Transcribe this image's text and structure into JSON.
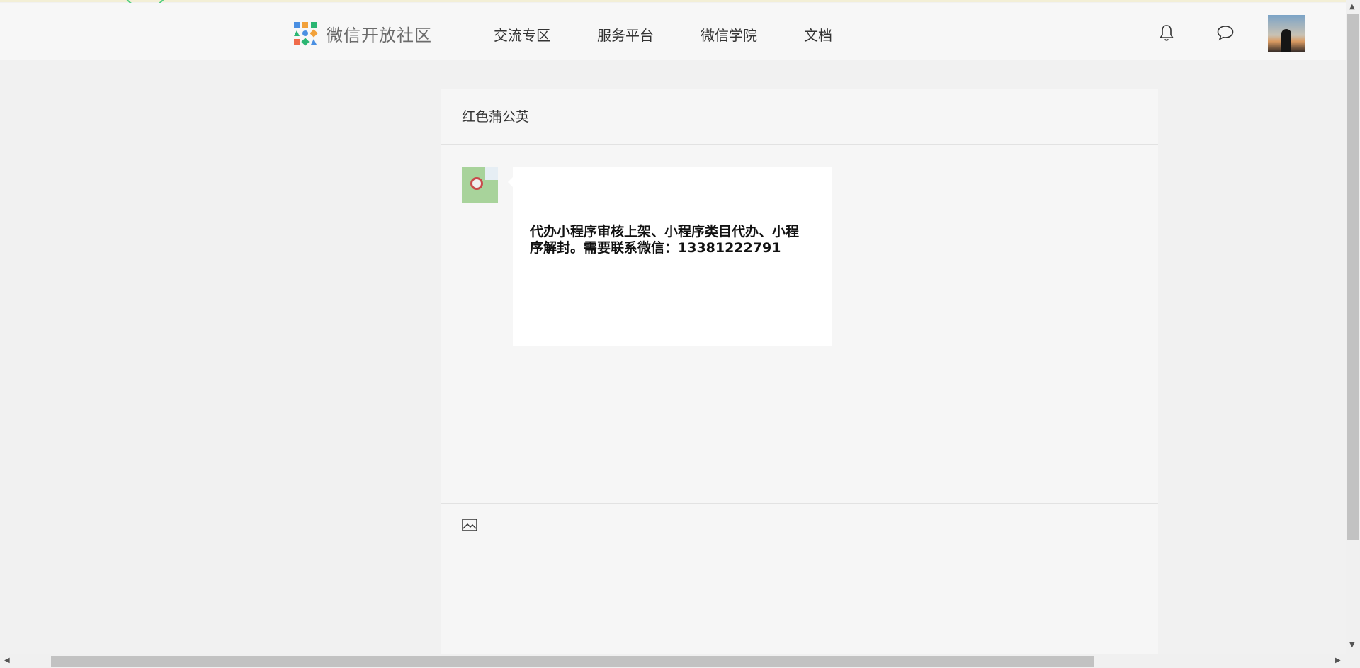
{
  "brand": {
    "name": "微信开放社区"
  },
  "nav": {
    "items": [
      "交流专区",
      "服务平台",
      "微信学院",
      "文档"
    ]
  },
  "header_icons": [
    "bell-icon",
    "chat-icon"
  ],
  "conversation": {
    "title": "红色蒲公英",
    "messages": [
      {
        "text": "代办小程序审核上架、小程序类目代办、小程序解封。需要联系微信：13381222791"
      }
    ]
  },
  "composer": {
    "tool_icon": "image-icon"
  },
  "colors": {
    "page_bg": "#f1f1f1",
    "panel_bg": "#f6f6f6",
    "bubble_bg": "#ffffff",
    "accent_green": "#4fce7e"
  }
}
